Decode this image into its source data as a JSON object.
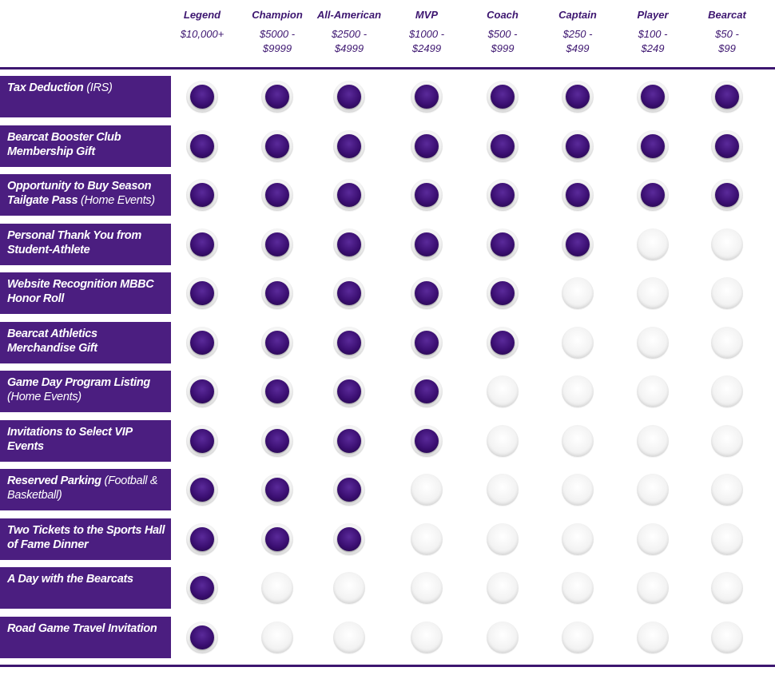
{
  "tiers": [
    {
      "name": "Legend",
      "range": "$10,000+"
    },
    {
      "name": "Champion",
      "range": "$5000 -\n$9999"
    },
    {
      "name": "All-American",
      "range": "$2500 -\n$4999"
    },
    {
      "name": "MVP",
      "range": "$1000 -\n$2499"
    },
    {
      "name": "Coach",
      "range": "$500 -\n$999"
    },
    {
      "name": "Captain",
      "range": "$250 -\n$499"
    },
    {
      "name": "Player",
      "range": "$100 -\n$249"
    },
    {
      "name": "Bearcat",
      "range": "$50 -\n$99"
    }
  ],
  "benefits": [
    {
      "main": "Tax Deduction",
      "sub": "(IRS)",
      "included_through_tier": 8
    },
    {
      "main": "Bearcat Booster Club Membership Gift",
      "sub": "",
      "included_through_tier": 8
    },
    {
      "main": "Opportunity to Buy Season Tailgate Pass",
      "sub": "(Home Events)",
      "included_through_tier": 8
    },
    {
      "main": "Personal Thank You from Student-Athlete",
      "sub": "",
      "included_through_tier": 6
    },
    {
      "main": "Website Recognition MBBC Honor Roll",
      "sub": "",
      "included_through_tier": 5
    },
    {
      "main": "Bearcat Athletics Merchandise Gift",
      "sub": "",
      "included_through_tier": 5
    },
    {
      "main": "Game Day Program Listing",
      "sub": "(Home Events)",
      "included_through_tier": 4
    },
    {
      "main": "Invitations to Select VIP Events",
      "sub": "",
      "included_through_tier": 4
    },
    {
      "main": "Reserved Parking",
      "sub": "(Football & Basketball)",
      "included_through_tier": 3
    },
    {
      "main": "Two Tickets to the Sports Hall of Fame Dinner",
      "sub": "",
      "included_through_tier": 3
    },
    {
      "main": "A Day with the Bearcats",
      "sub": "",
      "included_through_tier": 1
    },
    {
      "main": "Road Game Travel Invitation",
      "sub": "",
      "included_through_tier": 1
    }
  ],
  "colors": {
    "brand_purple": "#4b1e80",
    "text_purple": "#3d1670",
    "filled_dot": "#3b0f72",
    "empty_dot": "#f3f3f3"
  }
}
